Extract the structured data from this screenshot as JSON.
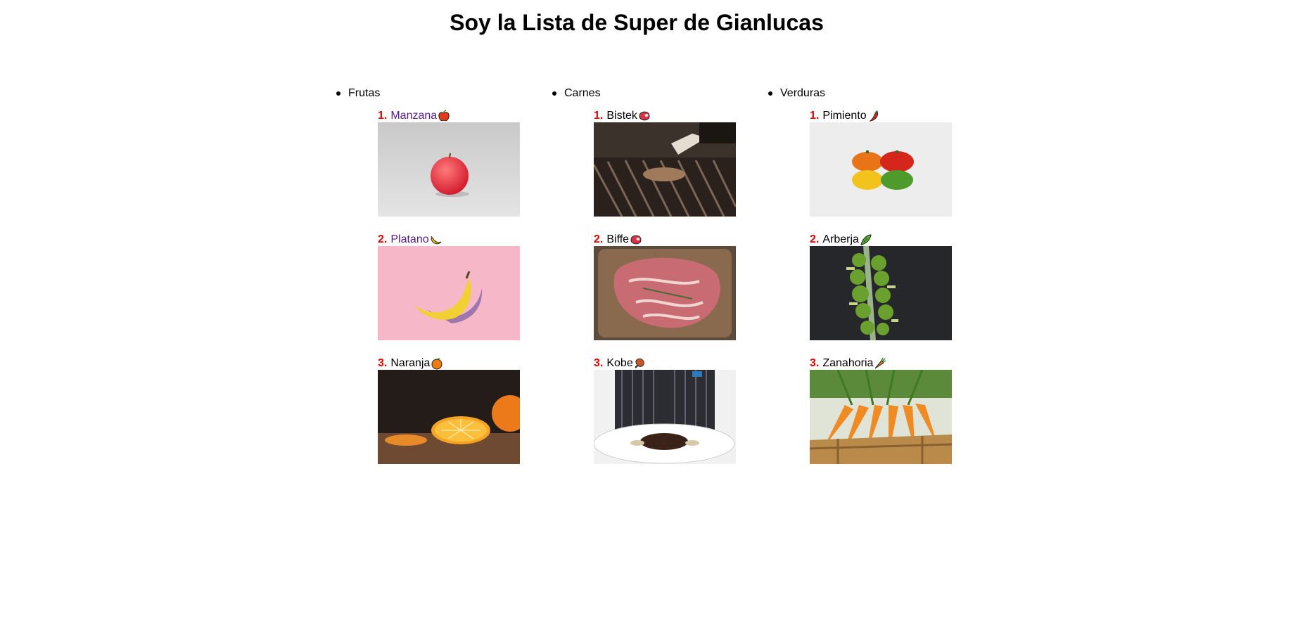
{
  "title": "Soy la Lista de Super de Gianlucas",
  "categories": [
    {
      "name": "Frutas",
      "items": [
        {
          "number": "1.",
          "name": "Manzana",
          "emoji": "apple-icon",
          "visited": true
        },
        {
          "number": "2.",
          "name": "Platano",
          "emoji": "banana-icon",
          "visited": true
        },
        {
          "number": "3.",
          "name": "Naranja",
          "emoji": "orange-icon",
          "visited": false
        }
      ]
    },
    {
      "name": "Carnes",
      "items": [
        {
          "number": "1.",
          "name": "Bistek",
          "emoji": "steak-icon",
          "visited": false
        },
        {
          "number": "2.",
          "name": "Biffe",
          "emoji": "steak-icon",
          "visited": false
        },
        {
          "number": "3.",
          "name": "Kobe",
          "emoji": "meat-leg-icon",
          "visited": false
        }
      ]
    },
    {
      "name": "Verduras",
      "items": [
        {
          "number": "1.",
          "name": "Pimiento",
          "emoji": "pepper-icon",
          "visited": false
        },
        {
          "number": "2.",
          "name": "Arberja",
          "emoji": "pea-pod-icon",
          "visited": false
        },
        {
          "number": "3.",
          "name": "Zanahoria",
          "emoji": "carrot-icon",
          "visited": false
        }
      ]
    }
  ],
  "colors": {
    "number": "#e60000",
    "visited_link": "#551a8b"
  }
}
